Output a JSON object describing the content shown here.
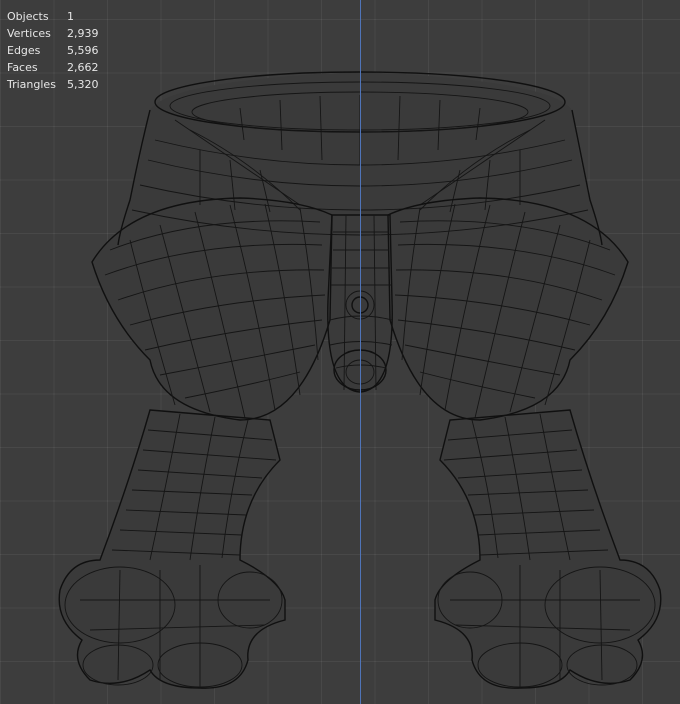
{
  "stats": {
    "objects_label": "Objects",
    "objects_value": "1",
    "vertices_label": "Vertices",
    "vertices_value": "2,939",
    "edges_label": "Edges",
    "edges_value": "5,596",
    "faces_label": "Faces",
    "faces_value": "2,662",
    "triangles_label": "Triangles",
    "triangles_value": "5,320"
  },
  "colors": {
    "background": "#3d3d3d",
    "grid": "#4a4a4a",
    "axis_line": "#4f74b8",
    "wire": "#151515",
    "text": "#e6e6e6"
  }
}
